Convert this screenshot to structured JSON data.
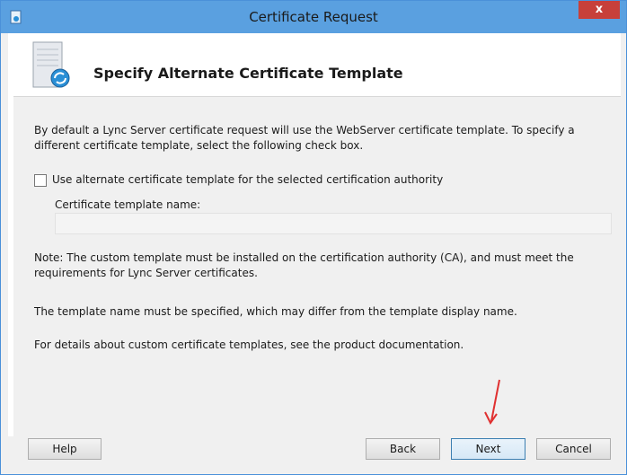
{
  "window": {
    "title": "Certificate Request",
    "close_label": "x"
  },
  "header": {
    "title": "Specify Alternate Certificate Template"
  },
  "content": {
    "intro": "By default a Lync Server certificate request will use the WebServer certificate template. To specify a different certificate template, select the following check box.",
    "checkbox_label": "Use alternate certificate template for the selected certification authority",
    "checkbox_checked": false,
    "field_label": "Certificate template name:",
    "field_value": "",
    "note": "Note: The custom template must be installed on the certification authority (CA), and must meet the requirements for Lync Server certificates.",
    "name_note": "The template name must be specified, which may differ from the template display name.",
    "details_note": "For details about custom certificate templates, see the product documentation."
  },
  "buttons": {
    "help": "Help",
    "back": "Back",
    "next": "Next",
    "cancel": "Cancel"
  },
  "colors": {
    "titlebar": "#5aa0e0",
    "close": "#c7403a",
    "annotation_arrow": "#e03030"
  },
  "icons": {
    "app": "certificate-app-icon",
    "header": "server-wizard-icon",
    "annotation": "red-arrow-icon"
  }
}
